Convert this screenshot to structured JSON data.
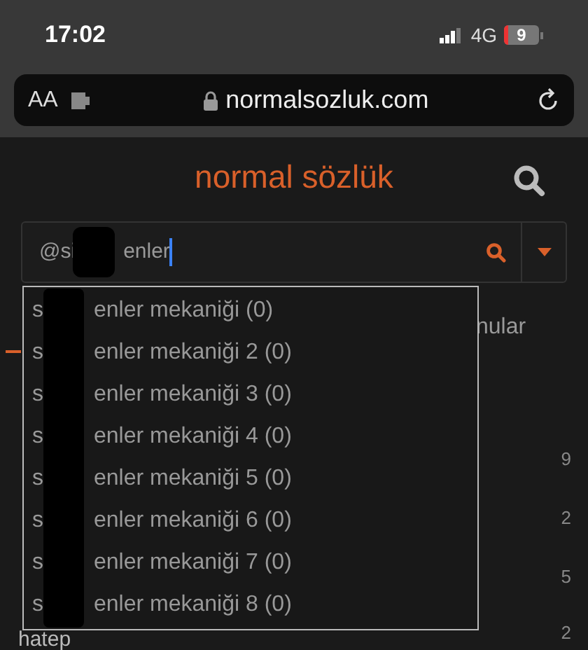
{
  "status_bar": {
    "time": "17:02",
    "network": "4G",
    "battery": "9"
  },
  "browser": {
    "text_size_button": "AA",
    "url": "normalsozluk.com"
  },
  "header": {
    "logo": "normal sözlük"
  },
  "search": {
    "value_start": "@si",
    "value_end": "enler"
  },
  "suggestions": [
    {
      "start": "s",
      "end": "enler mekaniği (0)"
    },
    {
      "start": "s",
      "end": "enler mekaniği 2 (0)"
    },
    {
      "start": "s",
      "end": "enler mekaniği 3 (0)"
    },
    {
      "start": "s",
      "end": "enler mekaniği 4 (0)"
    },
    {
      "start": "s",
      "end": "enler mekaniği 5 (0)"
    },
    {
      "start": "s",
      "end": "enler mekaniği 6 (0)"
    },
    {
      "start": "s",
      "end": "enler mekaniği 7 (0)"
    },
    {
      "start": "s",
      "end": "enler mekaniği 8 (0)"
    }
  ],
  "background": {
    "tab_label": "nular",
    "counts": [
      "9",
      "2",
      "5",
      "2"
    ],
    "topic": "hatep"
  }
}
